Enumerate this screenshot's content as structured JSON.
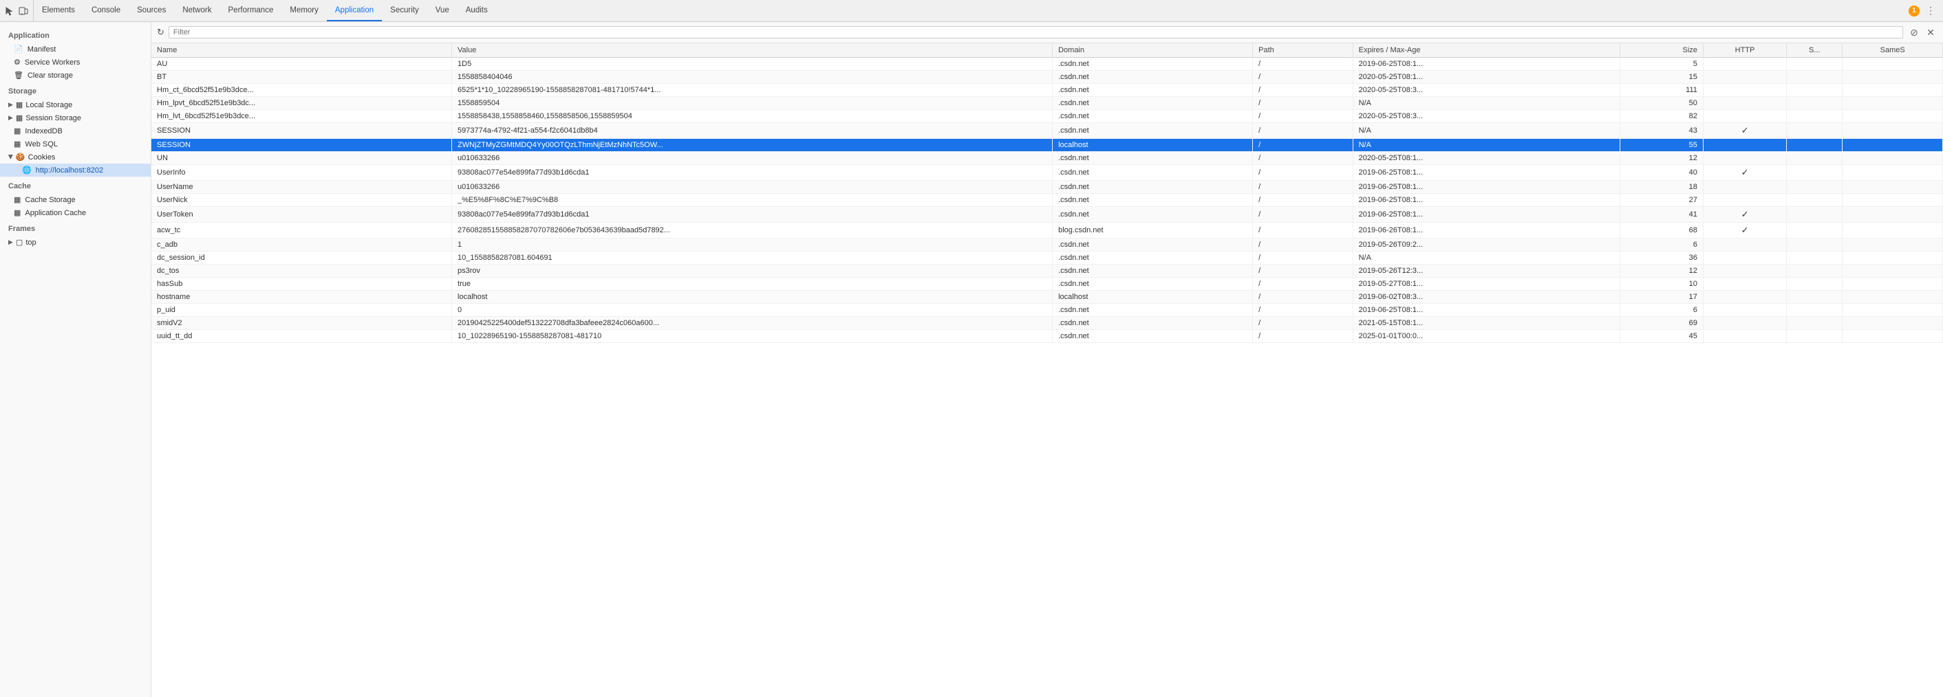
{
  "toolbar": {
    "icons": [
      "cursor-icon",
      "device-icon"
    ],
    "tabs": [
      {
        "id": "elements",
        "label": "Elements",
        "active": false
      },
      {
        "id": "console",
        "label": "Console",
        "active": false
      },
      {
        "id": "sources",
        "label": "Sources",
        "active": false
      },
      {
        "id": "network",
        "label": "Network",
        "active": false
      },
      {
        "id": "performance",
        "label": "Performance",
        "active": false
      },
      {
        "id": "memory",
        "label": "Memory",
        "active": false
      },
      {
        "id": "application",
        "label": "Application",
        "active": true
      },
      {
        "id": "security",
        "label": "Security",
        "active": false
      },
      {
        "id": "vue",
        "label": "Vue",
        "active": false
      },
      {
        "id": "audits",
        "label": "Audits",
        "active": false
      }
    ],
    "warning_count": "1",
    "more_icon": "⋮"
  },
  "sidebar": {
    "sections": [
      {
        "title": "Application",
        "items": [
          {
            "id": "manifest",
            "label": "Manifest",
            "icon": "📄",
            "indent": 1
          },
          {
            "id": "service-workers",
            "label": "Service Workers",
            "icon": "⚙",
            "indent": 1
          },
          {
            "id": "clear-storage",
            "label": "Clear storage",
            "icon": "🗑",
            "indent": 1
          }
        ]
      },
      {
        "title": "Storage",
        "items": [
          {
            "id": "local-storage",
            "label": "Local Storage",
            "icon": "▦",
            "indent": 1,
            "expandable": true
          },
          {
            "id": "session-storage",
            "label": "Session Storage",
            "icon": "▦",
            "indent": 1,
            "expandable": true
          },
          {
            "id": "indexeddb",
            "label": "IndexedDB",
            "icon": "▦",
            "indent": 1
          },
          {
            "id": "web-sql",
            "label": "Web SQL",
            "icon": "▦",
            "indent": 1
          },
          {
            "id": "cookies",
            "label": "Cookies",
            "icon": "🍪",
            "indent": 1,
            "expandable": true,
            "expanded": true
          },
          {
            "id": "cookies-localhost",
            "label": "http://localhost:8202",
            "icon": "🌐",
            "indent": 2,
            "active": true
          }
        ]
      },
      {
        "title": "Cache",
        "items": [
          {
            "id": "cache-storage",
            "label": "Cache Storage",
            "icon": "▦",
            "indent": 1
          },
          {
            "id": "application-cache",
            "label": "Application Cache",
            "icon": "▦",
            "indent": 1
          }
        ]
      },
      {
        "title": "Frames",
        "items": [
          {
            "id": "frames-top",
            "label": "top",
            "icon": "▢",
            "indent": 1,
            "expandable": true
          }
        ]
      }
    ]
  },
  "filter": {
    "placeholder": "Filter",
    "value": ""
  },
  "table": {
    "columns": [
      {
        "id": "name",
        "label": "Name"
      },
      {
        "id": "value",
        "label": "Value"
      },
      {
        "id": "domain",
        "label": "Domain"
      },
      {
        "id": "path",
        "label": "Path"
      },
      {
        "id": "expires",
        "label": "Expires / Max-Age"
      },
      {
        "id": "size",
        "label": "Size"
      },
      {
        "id": "http",
        "label": "HTTP"
      },
      {
        "id": "s",
        "label": "S..."
      },
      {
        "id": "samesite",
        "label": "SameS"
      }
    ],
    "rows": [
      {
        "name": "AU",
        "value": "1D5",
        "domain": ".csdn.net",
        "path": "/",
        "expires": "2019-06-25T08:1...",
        "size": "5",
        "http": "",
        "s": "",
        "samesite": "",
        "selected": false
      },
      {
        "name": "BT",
        "value": "1558858404046",
        "domain": ".csdn.net",
        "path": "/",
        "expires": "2020-05-25T08:1...",
        "size": "15",
        "http": "",
        "s": "",
        "samesite": "",
        "selected": false
      },
      {
        "name": "Hm_ct_6bcd52f51e9b3dce...",
        "value": "6525*1*10_10228965190-1558858287081-481710!5744*1...",
        "domain": ".csdn.net",
        "path": "/",
        "expires": "2020-05-25T08:3...",
        "size": "111",
        "http": "",
        "s": "",
        "samesite": "",
        "selected": false
      },
      {
        "name": "Hm_lpvt_6bcd52f51e9b3dc...",
        "value": "1558859504",
        "domain": ".csdn.net",
        "path": "/",
        "expires": "N/A",
        "size": "50",
        "http": "",
        "s": "",
        "samesite": "",
        "selected": false
      },
      {
        "name": "Hm_lvt_6bcd52f51e9b3dce...",
        "value": "1558858438,1558858460,1558858506,1558859504",
        "domain": ".csdn.net",
        "path": "/",
        "expires": "2020-05-25T08:3...",
        "size": "82",
        "http": "",
        "s": "",
        "samesite": "",
        "selected": false
      },
      {
        "name": "SESSION",
        "value": "5973774a-4792-4f21-a554-f2c6041db8b4",
        "domain": ".csdn.net",
        "path": "/",
        "expires": "N/A",
        "size": "43",
        "http": "✓",
        "s": "",
        "samesite": "",
        "selected": false
      },
      {
        "name": "SESSION",
        "value": "ZWNjZTMyZGMtMDQ4Yy00OTQzLThmNjEtMzNhNTc5OW...",
        "domain": "localhost",
        "path": "/",
        "expires": "N/A",
        "size": "55",
        "http": "",
        "s": "",
        "samesite": "",
        "selected": true
      },
      {
        "name": "UN",
        "value": "u010633266",
        "domain": ".csdn.net",
        "path": "/",
        "expires": "2020-05-25T08:1...",
        "size": "12",
        "http": "",
        "s": "",
        "samesite": "",
        "selected": false
      },
      {
        "name": "UserInfo",
        "value": "93808ac077e54e899fa77d93b1d6cda1",
        "domain": ".csdn.net",
        "path": "/",
        "expires": "2019-06-25T08:1...",
        "size": "40",
        "http": "✓",
        "s": "",
        "samesite": "",
        "selected": false
      },
      {
        "name": "UserName",
        "value": "u010633266",
        "domain": ".csdn.net",
        "path": "/",
        "expires": "2019-06-25T08:1...",
        "size": "18",
        "http": "",
        "s": "",
        "samesite": "",
        "selected": false
      },
      {
        "name": "UserNick",
        "value": "_%E5%8F%8C%E7%9C%B8",
        "domain": ".csdn.net",
        "path": "/",
        "expires": "2019-06-25T08:1...",
        "size": "27",
        "http": "",
        "s": "",
        "samesite": "",
        "selected": false
      },
      {
        "name": "UserToken",
        "value": "93808ac077e54e899fa77d93b1d6cda1",
        "domain": ".csdn.net",
        "path": "/",
        "expires": "2019-06-25T08:1...",
        "size": "41",
        "http": "✓",
        "s": "",
        "samesite": "",
        "selected": false
      },
      {
        "name": "acw_tc",
        "value": "276082851558858287070782606e7b053643639baad5d7892...",
        "domain": "blog.csdn.net",
        "path": "/",
        "expires": "2019-06-26T08:1...",
        "size": "68",
        "http": "✓",
        "s": "",
        "samesite": "",
        "selected": false
      },
      {
        "name": "c_adb",
        "value": "1",
        "domain": ".csdn.net",
        "path": "/",
        "expires": "2019-05-26T09:2...",
        "size": "6",
        "http": "",
        "s": "",
        "samesite": "",
        "selected": false
      },
      {
        "name": "dc_session_id",
        "value": "10_1558858287081.604691",
        "domain": ".csdn.net",
        "path": "/",
        "expires": "N/A",
        "size": "36",
        "http": "",
        "s": "",
        "samesite": "",
        "selected": false
      },
      {
        "name": "dc_tos",
        "value": "ps3rov",
        "domain": ".csdn.net",
        "path": "/",
        "expires": "2019-05-26T12:3...",
        "size": "12",
        "http": "",
        "s": "",
        "samesite": "",
        "selected": false
      },
      {
        "name": "hasSub",
        "value": "true",
        "domain": ".csdn.net",
        "path": "/",
        "expires": "2019-05-27T08:1...",
        "size": "10",
        "http": "",
        "s": "",
        "samesite": "",
        "selected": false
      },
      {
        "name": "hostname",
        "value": "localhost",
        "domain": "localhost",
        "path": "/",
        "expires": "2019-06-02T08:3...",
        "size": "17",
        "http": "",
        "s": "",
        "samesite": "",
        "selected": false
      },
      {
        "name": "p_uid",
        "value": "0",
        "domain": ".csdn.net",
        "path": "/",
        "expires": "2019-06-25T08:1...",
        "size": "6",
        "http": "",
        "s": "",
        "samesite": "",
        "selected": false
      },
      {
        "name": "smidV2",
        "value": "20190425225400def513222708dfa3bafeee2824c060a600...",
        "domain": ".csdn.net",
        "path": "/",
        "expires": "2021-05-15T08:1...",
        "size": "69",
        "http": "",
        "s": "",
        "samesite": "",
        "selected": false
      },
      {
        "name": "uuid_tt_dd",
        "value": "10_10228965190-1558858287081-481710",
        "domain": ".csdn.net",
        "path": "/",
        "expires": "2025-01-01T00:0...",
        "size": "45",
        "http": "",
        "s": "",
        "samesite": "",
        "selected": false
      }
    ]
  }
}
